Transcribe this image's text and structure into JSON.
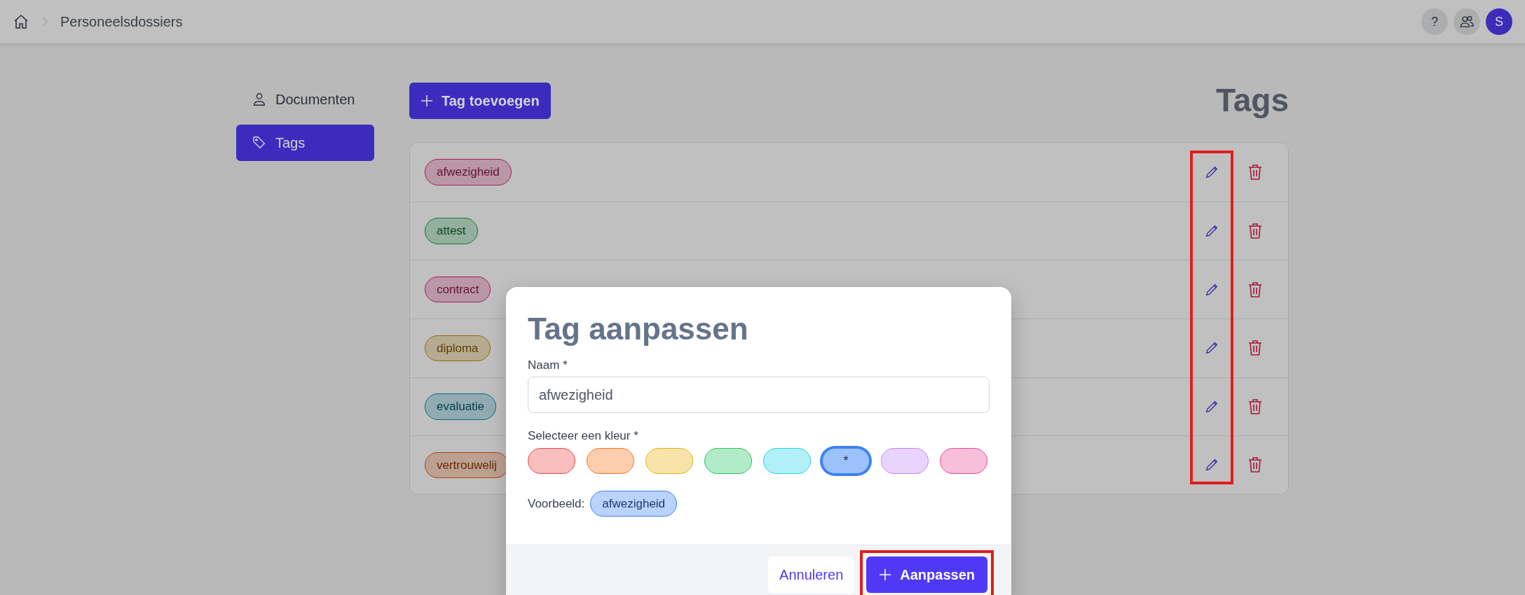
{
  "topbar": {
    "breadcrumb": [
      "Personeelsdossiers"
    ],
    "help": "?",
    "avatar": "S"
  },
  "sidebar": {
    "items": [
      {
        "label": "Documenten",
        "selected": false
      },
      {
        "label": "Tags",
        "selected": true
      }
    ]
  },
  "toolbar": {
    "add_button": "Tag toevoegen",
    "heading": "Tags"
  },
  "tags": {
    "edit_column_highlighted": true,
    "rows": [
      {
        "name": "afwezigheid",
        "color": "#a41d59"
      },
      {
        "name": "attest",
        "color": "#117a38"
      },
      {
        "name": "contract",
        "color": "#a41d59"
      },
      {
        "name": "diploma",
        "color": "#986803"
      },
      {
        "name": "evaluatie",
        "color": "#066d86"
      },
      {
        "name": "vertrouwelij",
        "color": "#b04209"
      }
    ]
  },
  "modal": {
    "title": "Tag aanpassen",
    "name_label": "Naam *",
    "name_value": "afwezigheid",
    "color_label": "Selecteer een kleur *",
    "swatches": [
      {
        "color": "#ef4444",
        "selected": false
      },
      {
        "color": "#f97316",
        "selected": false
      },
      {
        "color": "#eab308",
        "selected": false
      },
      {
        "color": "#22c55e",
        "selected": false
      },
      {
        "color": "#22d3ee",
        "selected": false
      },
      {
        "color": "#3b82f6",
        "selected": true,
        "label": "*"
      },
      {
        "color": "#c084fc",
        "selected": false
      },
      {
        "color": "#ec4899",
        "selected": false
      }
    ],
    "preview_label": "Voorbeeld:",
    "preview_tag": "afwezigheid",
    "cancel_button": "Annuleren",
    "submit_button": "Aanpassen",
    "submit_highlighted": true
  }
}
